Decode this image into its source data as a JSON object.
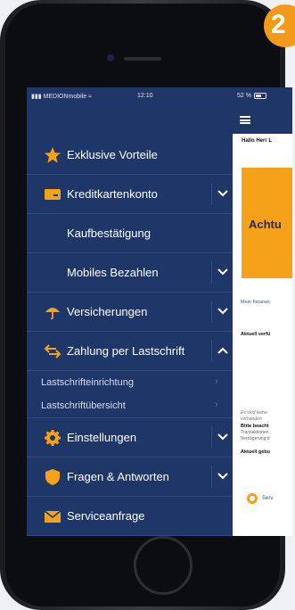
{
  "status_bar": {
    "carrier": "MEDIONmobile",
    "time": "12:10",
    "battery": "52 %"
  },
  "menu": {
    "items": [
      {
        "label": "Exklusive Vorteile",
        "icon": "star-icon"
      },
      {
        "label": "Kreditkartenkonto",
        "icon": "credit-card-icon",
        "expand": "down"
      },
      {
        "label": "Kaufbestätigung"
      },
      {
        "label": "Mobiles Bezahlen",
        "expand": "down"
      },
      {
        "label": "Versicherungen",
        "icon": "umbrella-icon",
        "expand": "down"
      },
      {
        "label": "Zahlung per Lastschrift",
        "icon": "transfer-arrows-icon",
        "expand": "up"
      }
    ],
    "subitems": [
      {
        "label": "Lastschrifteinrichtung"
      },
      {
        "label": "Lastschriftübersicht"
      }
    ],
    "items2": [
      {
        "label": "Einstellungen",
        "icon": "gear-icon",
        "expand": "down"
      },
      {
        "label": "Fragen & Antworten",
        "icon": "shield-icon",
        "expand": "down"
      },
      {
        "label": "Serviceanfrage",
        "icon": "envelope-icon"
      }
    ]
  },
  "content": {
    "greeting": "Hallo Herr L",
    "alert": "Achtu",
    "link": "Mein Finanzs",
    "available": "Aktuell verfü",
    "no_data_1": "Es sind keine",
    "no_data_2": "vorhanden",
    "notice": "Bitte beacht",
    "notice_1": "Transaktionen",
    "notice_2": "Verzögerung d",
    "booked": "Aktuell gebu",
    "service": "Serv"
  },
  "badge": "2",
  "colors": {
    "menu_bg": "#1e3768",
    "accent": "#f6a11a",
    "divider": "#2c4a83"
  }
}
